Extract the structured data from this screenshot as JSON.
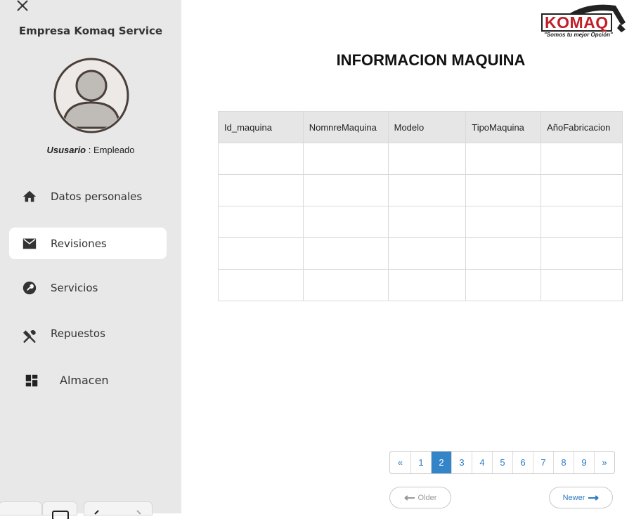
{
  "sidebar": {
    "company": "Empresa Komaq Service",
    "user_key": "Ususario",
    "user_sep": " : ",
    "user_role": "Empleado",
    "items": [
      {
        "label": "Datos personales",
        "icon": "home-icon"
      },
      {
        "label": "Revisiones",
        "icon": "mail-icon",
        "active": true
      },
      {
        "label": "Servicios",
        "icon": "wrench-icon"
      },
      {
        "label": "Repuestos",
        "icon": "tools-icon"
      },
      {
        "label": "Almacen",
        "icon": "dashboard-icon"
      }
    ]
  },
  "logo": {
    "brand": "KOMAQ",
    "tagline": "\"Somos tu mejor Opción\""
  },
  "main": {
    "title": "INFORMACION MAQUINA",
    "columns": [
      "Id_maquina",
      "NomnreMaquina",
      "Modelo",
      "TipoMaquina",
      "AñoFabricacion"
    ]
  },
  "pagination": {
    "prev": "«",
    "pages": [
      "1",
      "2",
      "3",
      "4",
      "5",
      "6",
      "7",
      "8",
      "9"
    ],
    "next": "»",
    "current": "2",
    "older": "Older",
    "newer": "Newer"
  },
  "colors": {
    "sidebar_bg": "#e8e8e8",
    "accent": "#3385c8",
    "logo_red": "#c0202a"
  }
}
